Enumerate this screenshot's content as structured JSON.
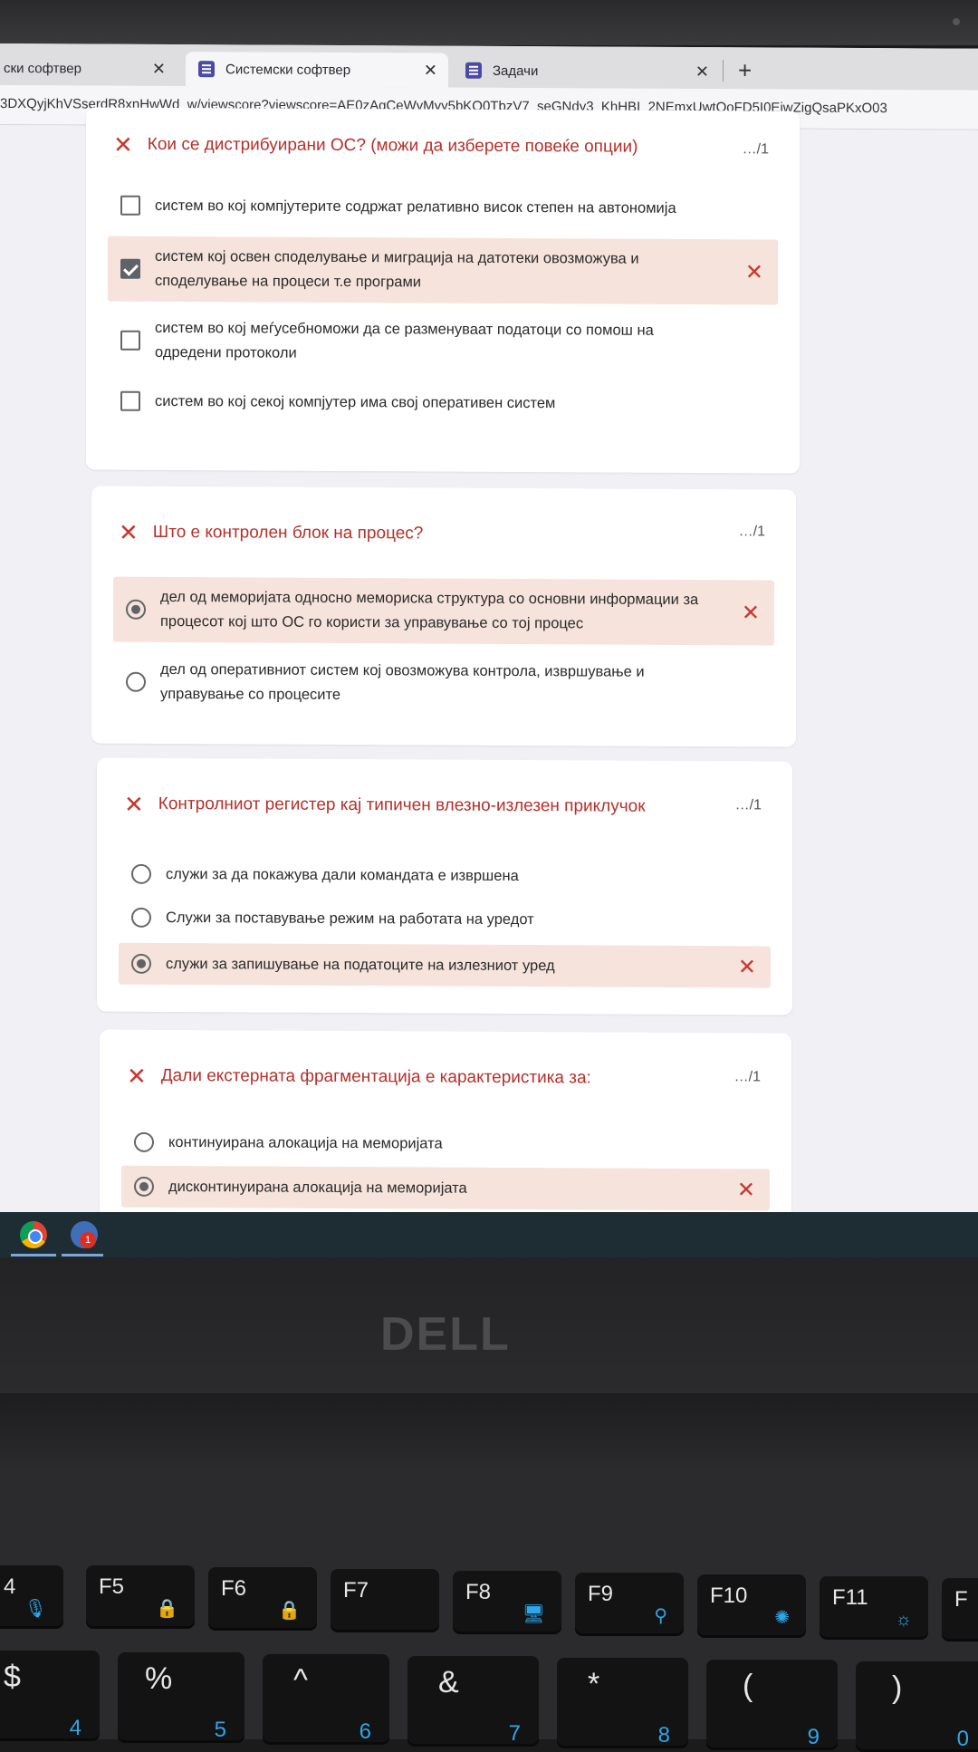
{
  "browser": {
    "tabs": [
      {
        "label": "ски софтвер"
      },
      {
        "label": "Системски софтвер"
      },
      {
        "label": "Задачи"
      }
    ],
    "close_glyph": "✕",
    "new_tab_glyph": "+",
    "url": "3DXQyjKhVSserdR8xnHwWd_w/viewscore?viewscore=AE0zAgCeWyMyy5bKO0TbzV7_seGNdy3_KhHBI_2NEmxUwtOoFD5I0EjwZigQsaPKxO03"
  },
  "quiz": {
    "wrong_mark": "✕",
    "questions": [
      {
        "title": "Кои се дистрибуирани ОС? (можи да изберете повеќе опции)",
        "score": "…/1",
        "options": [
          "систем во кој компјутерите содржат релативно висок степен на автономија",
          "систем кој освен споделување и миграција на датотеки овозможува и споделување на процеси т.е програми",
          "систем во кој меѓусебноможи да се разменуваат податоци со помош на одредени протоколи",
          "систем во кој секој компјутер има свој оперативен систем"
        ]
      },
      {
        "title": "Што е контролен блок на процес?",
        "score": "…/1",
        "options": [
          "дел од меморијата односно мемориска структура со основни информации за процесот кој што ОС го користи за управување со тој процес",
          "дел од оперативниот систем кој овозможува контрола, извршување и управување со процесите"
        ]
      },
      {
        "title": "Контролниот регистер кај типичен влезно-излезен приклучок",
        "score": "…/1",
        "options": [
          "служи за да покажува дали командата е извршена",
          "Служи за поставување режим на работата на уредот",
          "служи за запишување на податоците на излезниот уред"
        ]
      },
      {
        "title": "Дали екстерната фрагментација е карактеристика за:",
        "score": "…/1",
        "options": [
          "континуирана алокација на меморијата",
          "дисконтинуирана алокација на меморијата"
        ]
      }
    ]
  },
  "taskbar": {
    "badge": "1"
  },
  "laptop": {
    "brand": "DELL",
    "fkeys": [
      "4",
      "F5",
      "F6",
      "F7",
      "F8",
      "F9",
      "F10",
      "F11",
      "F"
    ],
    "numkeys": [
      {
        "sym": "$",
        "num": "4"
      },
      {
        "sym": "%",
        "num": "5"
      },
      {
        "sym": "^",
        "num": "6"
      },
      {
        "sym": "&",
        "num": "7"
      },
      {
        "sym": "*",
        "num": "8"
      },
      {
        "sym": "(",
        "num": "9"
      },
      {
        "sym": ")",
        "num": "0"
      }
    ]
  }
}
